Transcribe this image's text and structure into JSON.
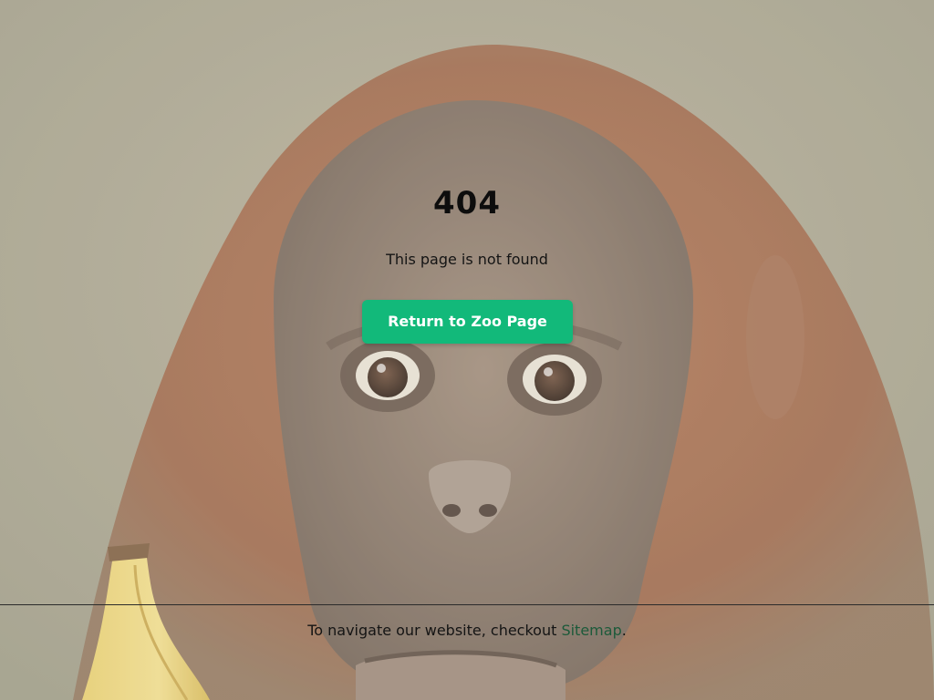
{
  "error": {
    "code": "404",
    "message": "This page is not found"
  },
  "actions": {
    "return_label": "Return to Zoo Page"
  },
  "footer": {
    "prefix": "To navigate our website, checkout ",
    "link_label": "Sitemap",
    "suffix": "."
  },
  "background": {
    "subject": "orangutan-face",
    "prop": "banana",
    "palette": {
      "fur": "#9a5a3c",
      "skin": "#8a7a6a",
      "backdrop": "#a9a48f",
      "accent_button": "#12b97a"
    }
  }
}
